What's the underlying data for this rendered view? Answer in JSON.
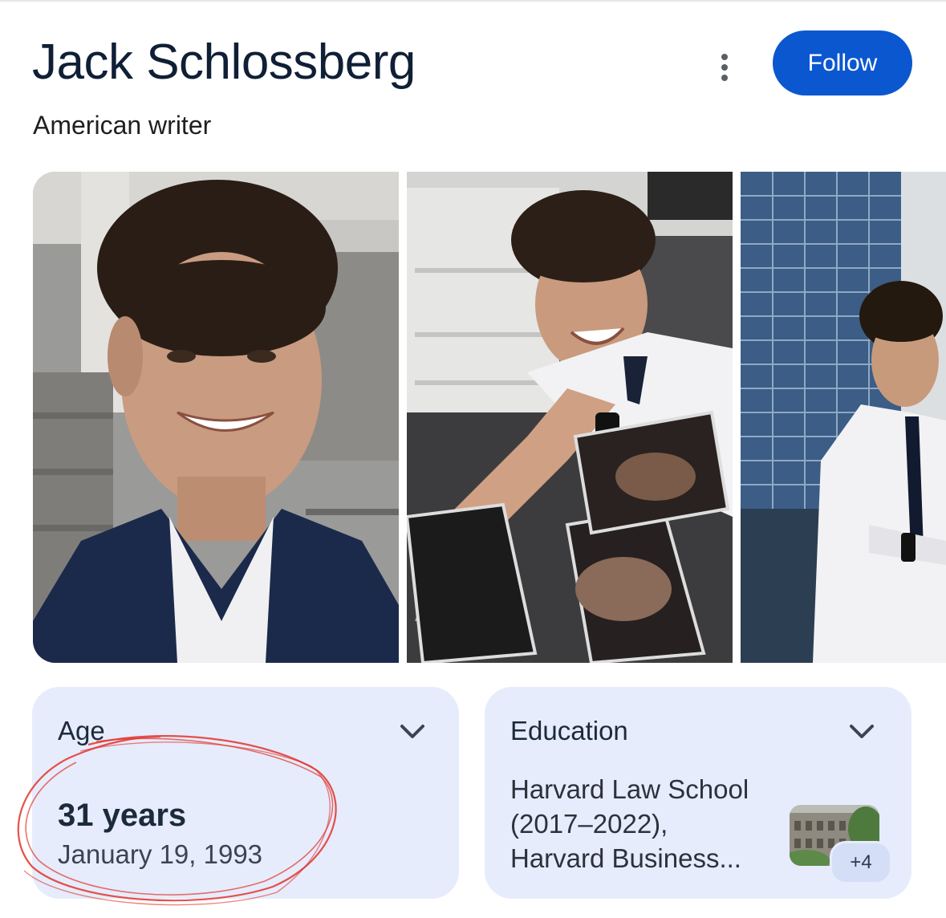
{
  "header": {
    "title": "Jack Schlossberg",
    "subtitle": "American writer",
    "follow_label": "Follow",
    "more_icon": "more-vert-icon",
    "accent_color": "#0b57d0"
  },
  "gallery": {
    "images": [
      {
        "alt": "portrait"
      },
      {
        "alt": "office photo"
      },
      {
        "alt": "city photo"
      }
    ]
  },
  "cards": {
    "age": {
      "label": "Age",
      "value": "31 years",
      "date": "January 19, 1993",
      "icon": "chevron-down-icon"
    },
    "education": {
      "label": "Education",
      "lines": [
        "Harvard Law School",
        "(2017–2022),",
        "Harvard Business..."
      ],
      "more_count": "+4",
      "icon": "chevron-down-icon"
    }
  },
  "annotation": {
    "color": "#e2342b"
  }
}
